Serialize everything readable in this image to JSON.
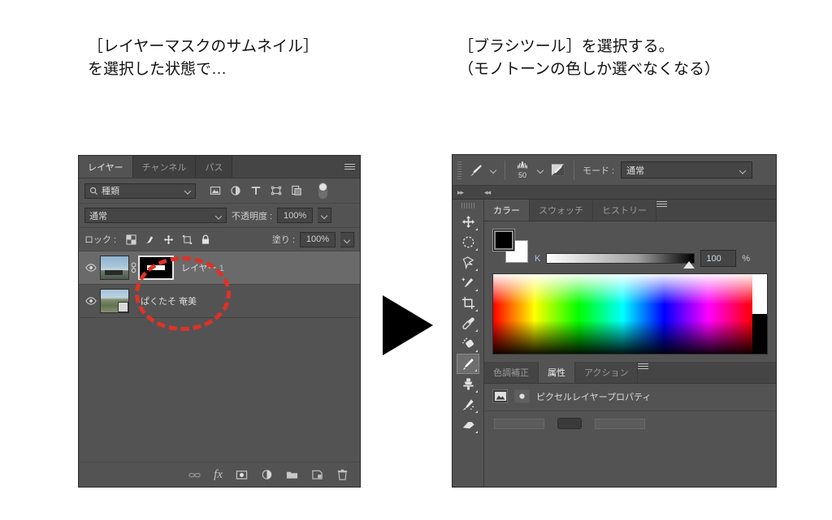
{
  "captions": {
    "left": "［レイヤーマスクのサムネイル］\nを選択した状態で…",
    "right": "［ブラシツール］を選択する。\n（モノトーンの色しか選べなくなる）"
  },
  "layers_panel": {
    "tabs": [
      {
        "label": "レイヤー",
        "active": true
      },
      {
        "label": "チャンネル",
        "active": false
      },
      {
        "label": "パス",
        "active": false
      }
    ],
    "menu_icon": "hamburger-menu-icon",
    "filter": {
      "kind_label": "種類",
      "search_icon": "search-icon",
      "icons": [
        "pixel-filter-icon",
        "adjustment-filter-icon",
        "type-filter-icon",
        "shape-filter-icon",
        "smart-object-filter-icon"
      ],
      "toggle_icon": "filter-toggle-switch"
    },
    "blend": {
      "mode": "通常",
      "opacity_label": "不透明度 :",
      "opacity_value": "100%"
    },
    "lock": {
      "label": "ロック :",
      "icons": [
        "lock-transparent-icon",
        "lock-image-icon",
        "lock-position-icon",
        "lock-artboard-icon",
        "lock-all-icon"
      ],
      "fill_label": "塗り :",
      "fill_value": "100%"
    },
    "layers": [
      {
        "name_prefix": "レイヤー ",
        "name_num": "1",
        "visible_icon": "eye-icon",
        "thumb": "sky-photo-thumbnail",
        "link_icon": "link-icon",
        "mask": "layer-mask-thumbnail",
        "selected": true
      },
      {
        "name_prefix": "ぱくたそ  奄美",
        "name_num": "",
        "visible_icon": "eye-icon",
        "thumb": "landscape-photo-thumbnail",
        "link_icon": "",
        "mask": "",
        "selected": false
      }
    ],
    "footer_icons": [
      "link-layers-icon",
      "fx-icon",
      "add-mask-icon",
      "adjustment-layer-icon",
      "new-group-icon",
      "new-layer-icon",
      "delete-layer-icon"
    ],
    "footer_fx_label": "fx"
  },
  "highlight": {
    "shape": "red-dashed-ellipse",
    "color": "#e03127"
  },
  "arrow": {
    "direction": "right",
    "color": "#000000"
  },
  "photoshop_right": {
    "options_bar": {
      "brush_icon": "brush-tool-icon",
      "brush_chevron": "chevron-down-icon",
      "brush_preset_icon": "brush-tip-icon",
      "brush_size": "50",
      "preset_chevron": "chevron-down-icon",
      "brush_panel_icon": "brush-settings-panel-icon",
      "mode_label": "モード :",
      "mode_value": "通常"
    },
    "collapse_bar": {
      "expand_icon": "expand-panels-icon",
      "collapse_icon": "collapse-panels-icon"
    },
    "toolbar": [
      {
        "name": "move-tool",
        "active": false
      },
      {
        "name": "marquee-tool",
        "active": false
      },
      {
        "name": "lasso-tool",
        "active": false
      },
      {
        "name": "quick-selection-tool",
        "active": false
      },
      {
        "name": "crop-tool",
        "active": false
      },
      {
        "name": "eyedropper-tool",
        "active": false
      },
      {
        "name": "healing-brush-tool",
        "active": false
      },
      {
        "name": "brush-tool",
        "active": true
      },
      {
        "name": "clone-stamp-tool",
        "active": false
      },
      {
        "name": "history-brush-tool",
        "active": false
      },
      {
        "name": "eraser-tool",
        "active": false
      }
    ],
    "color_panel": {
      "tabs": [
        {
          "label": "カラー",
          "active": true
        },
        {
          "label": "スウォッチ",
          "active": false
        },
        {
          "label": "ヒストリー",
          "active": false
        }
      ],
      "menu_icon": "hamburger-menu-icon",
      "foreground_color": "#000000",
      "background_color": "#ffffff",
      "slider_label": "K",
      "slider_value": "100",
      "slider_unit": "%",
      "spectrum": "color-spectrum-ramp"
    },
    "properties_panel": {
      "tabs": [
        {
          "label": "色調補正",
          "active": false
        },
        {
          "label": "属性",
          "active": true
        },
        {
          "label": "アクション",
          "active": false
        }
      ],
      "menu_icon": "hamburger-menu-icon",
      "title": "ピクセルレイヤープロパティ",
      "icon_left": "pixel-layer-icon",
      "icon_right": "mask-icon"
    }
  }
}
